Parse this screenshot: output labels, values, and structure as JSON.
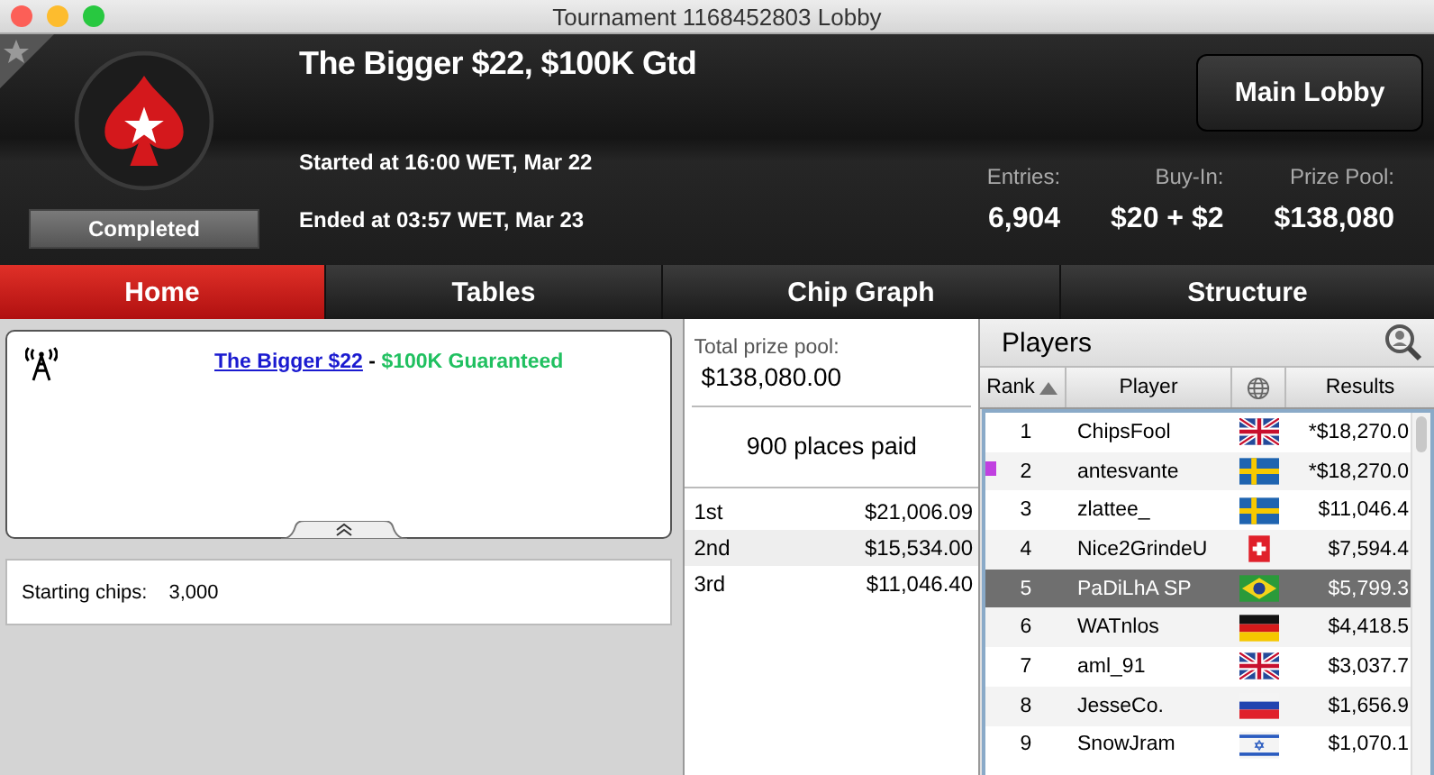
{
  "window": {
    "title": "Tournament 1168452803 Lobby"
  },
  "header": {
    "favorite": false,
    "status": "Completed",
    "title": "The Bigger $22, $100K Gtd",
    "started": "Started at 16:00 WET, Mar 22",
    "ended": "Ended at 03:57 WET, Mar 23",
    "main_lobby_button": "Main Lobby",
    "stats": [
      {
        "label": "Entries:",
        "value": "6,904"
      },
      {
        "label": "Buy-In:",
        "value": "$20 + $2"
      },
      {
        "label": "Prize Pool:",
        "value": "$138,080"
      }
    ]
  },
  "tabs": [
    {
      "label": "Home",
      "selected": true
    },
    {
      "label": "Tables",
      "selected": false
    },
    {
      "label": "Chip Graph",
      "selected": false
    },
    {
      "label": "Structure",
      "selected": false
    }
  ],
  "news": {
    "link": "The Bigger $22",
    "separator": "-",
    "highlight": "$100K Guaranteed"
  },
  "starting_chips": {
    "label": "Starting chips:",
    "value": "3,000"
  },
  "prizes": {
    "label": "Total prize pool:",
    "total": "$138,080.00",
    "places_paid": "900 places paid",
    "rows": [
      {
        "place": "1st",
        "amount": "$21,006.09"
      },
      {
        "place": "2nd",
        "amount": "$15,534.00"
      },
      {
        "place": "3rd",
        "amount": "$11,046.40"
      }
    ]
  },
  "players": {
    "title": "Players",
    "columns": [
      "Rank",
      "Player",
      "Results"
    ],
    "rows": [
      {
        "rank": "1",
        "name": "ChipsFool",
        "kind": "gb",
        "result": "*$18,270.0",
        "selected": false,
        "marked": false
      },
      {
        "rank": "2",
        "name": "antesvante",
        "kind": "se",
        "result": "*$18,270.0",
        "selected": false,
        "marked": true
      },
      {
        "rank": "3",
        "name": "zlattee_",
        "kind": "se",
        "result": "$11,046.4",
        "selected": false,
        "marked": false
      },
      {
        "rank": "4",
        "name": "Nice2GrindeU",
        "kind": "ch",
        "result": "$7,594.4",
        "selected": false,
        "marked": false
      },
      {
        "rank": "5",
        "name": "PaDiLhA SP",
        "kind": "br",
        "result": "$5,799.3",
        "selected": true,
        "marked": false
      },
      {
        "rank": "6",
        "name": "WATnlos",
        "kind": "de",
        "result": "$4,418.5",
        "selected": false,
        "marked": false
      },
      {
        "rank": "7",
        "name": "aml_91",
        "kind": "gb",
        "result": "$3,037.7",
        "selected": false,
        "marked": false
      },
      {
        "rank": "8",
        "name": "JesseCo.",
        "kind": "ru",
        "result": "$1,656.9",
        "selected": false,
        "marked": false
      },
      {
        "rank": "9",
        "name": "SnowJram",
        "kind": "il",
        "result": "$1,070.1",
        "selected": false,
        "marked": false
      }
    ]
  }
}
